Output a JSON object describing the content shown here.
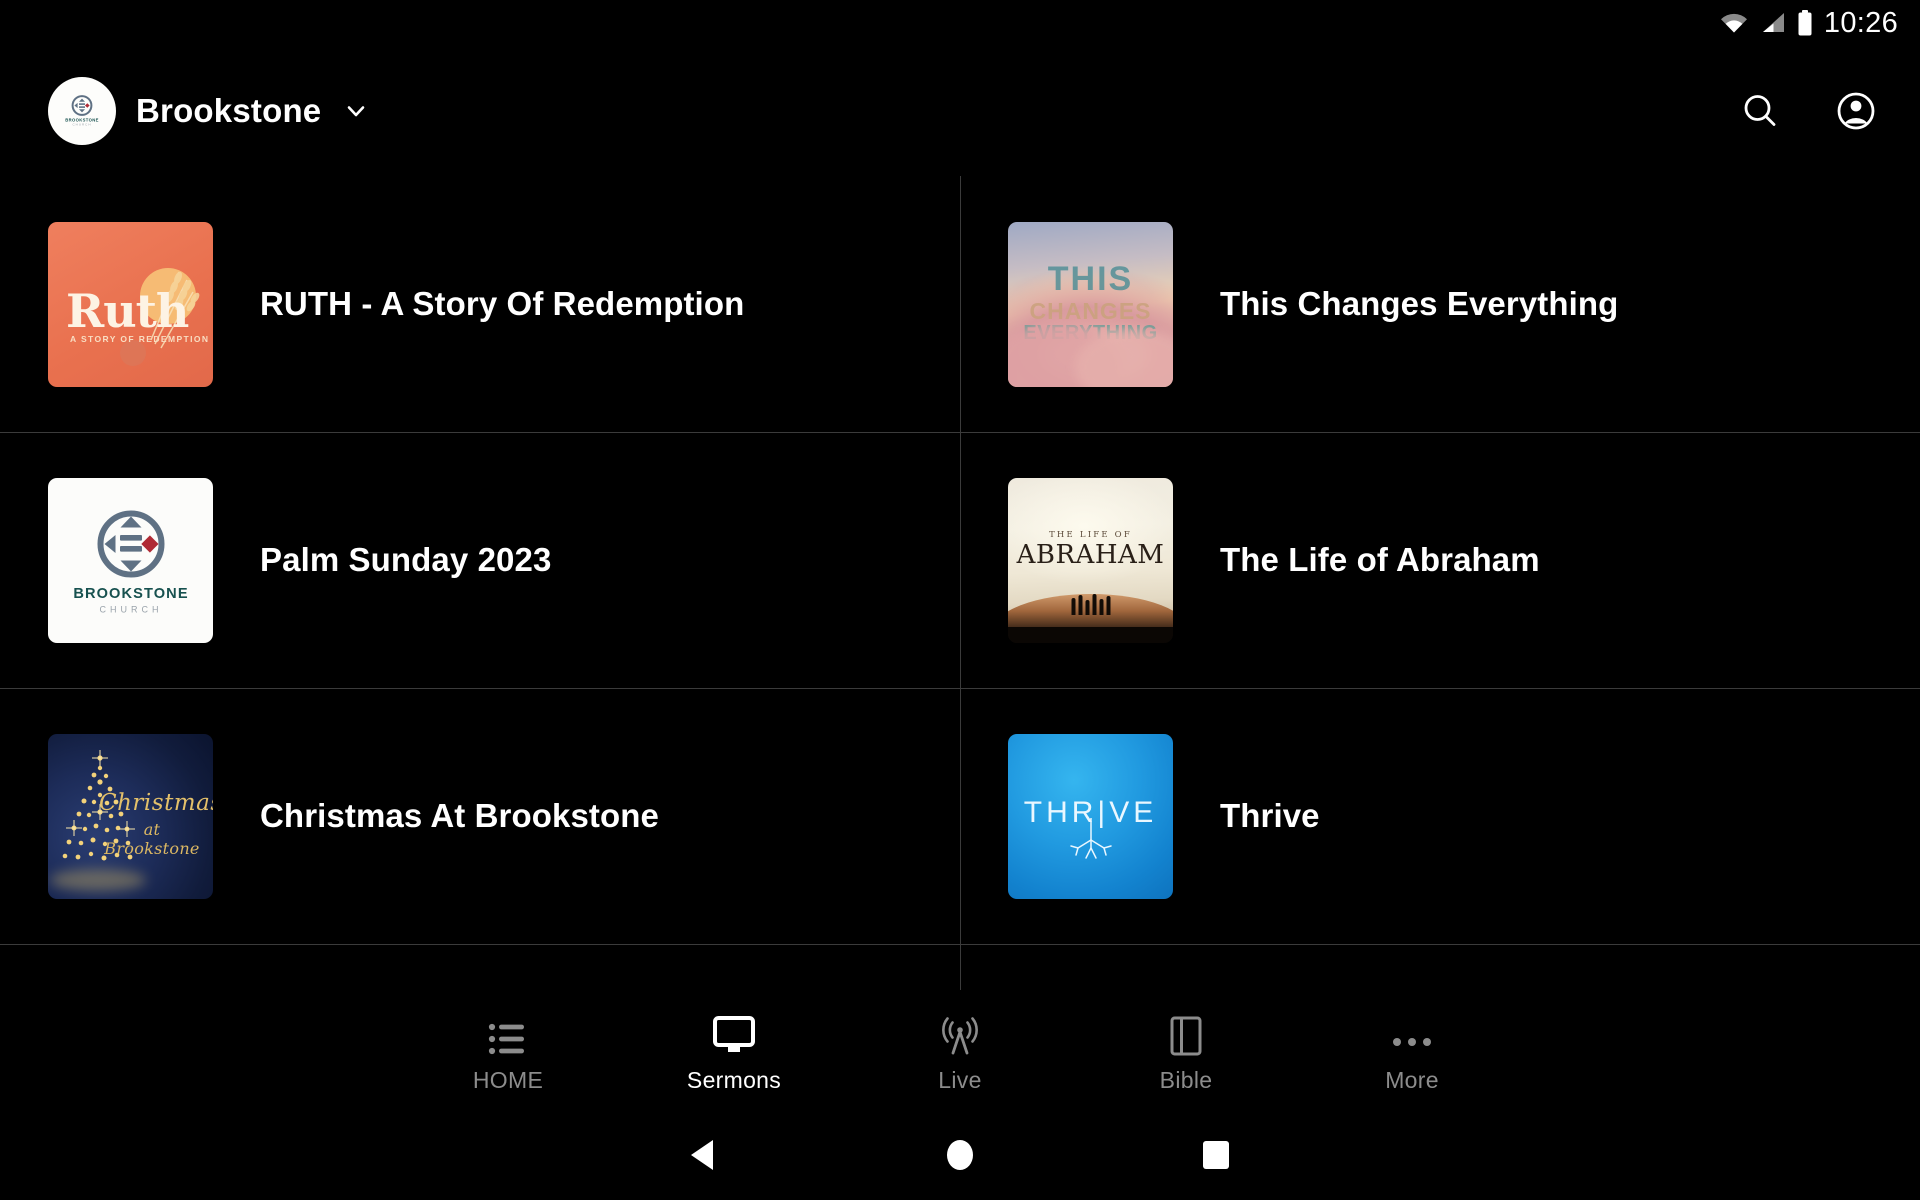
{
  "status_bar": {
    "time": "10:26",
    "icons": [
      "wifi-icon",
      "cellular-signal-icon",
      "battery-icon"
    ]
  },
  "header": {
    "brand_name": "Brookstone",
    "avatar_icon": "brookstone-church-logo",
    "dropdown_icon": "chevron-down-icon",
    "search_icon": "search-icon",
    "account_icon": "account-circle-icon"
  },
  "series_list": [
    {
      "title": "RUTH - A Story Of Redemption",
      "thumb": {
        "style": "ruth",
        "word": "Ruth",
        "sub": "A STORY OF REDEMPTION",
        "bg_color": "#e9714f"
      }
    },
    {
      "title": "This Changes Everything",
      "thumb": {
        "style": "tce",
        "line1": "THIS",
        "line2": "CHANGES",
        "line3": "EVERYTHING",
        "bg_color": "#d99b9f"
      }
    },
    {
      "title": "Palm Sunday 2023",
      "thumb": {
        "style": "brookstone",
        "word": "BROOKSTONE",
        "sub": "CHURCH",
        "bg_color": "#fcfcfa",
        "mark_color": "#5f7184",
        "accent_color": "#b02a35",
        "word_color": "#17514f"
      }
    },
    {
      "title": "The Life of Abraham",
      "thumb": {
        "style": "abraham",
        "sub": "THE LIFE OF",
        "word": "ABRAHAM",
        "bg_color": "#efeade"
      }
    },
    {
      "title": "Christmas At Brookstone",
      "thumb": {
        "style": "christmas",
        "line1": "Christmas",
        "line2": "at Brookstone",
        "bg_color": "#1d2c59",
        "accent_color": "#e3c06a"
      }
    },
    {
      "title": "Thrive",
      "thumb": {
        "style": "thrive",
        "word": "THR|VE",
        "bg_color": "#219ae0"
      }
    }
  ],
  "tab_bar": {
    "active_index": 1,
    "tabs": [
      {
        "label": "HOME",
        "icon": "list-icon"
      },
      {
        "label": "Sermons",
        "icon": "monitor-icon"
      },
      {
        "label": "Live",
        "icon": "broadcast-tower-icon"
      },
      {
        "label": "Bible",
        "icon": "book-icon"
      },
      {
        "label": "More",
        "icon": "ellipsis-icon"
      }
    ]
  },
  "system_nav": {
    "back_icon": "triangle-back-icon",
    "home_icon": "circle-home-icon",
    "recents_icon": "square-recents-icon"
  }
}
